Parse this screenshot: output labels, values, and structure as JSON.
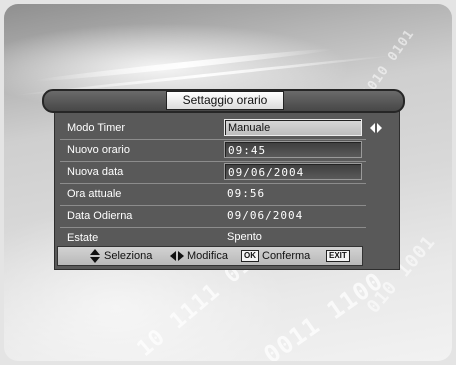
{
  "dialog": {
    "title": "Settaggio orario"
  },
  "rows": [
    {
      "label": "Modo Timer",
      "value": "Manuale"
    },
    {
      "label": "Nuovo orario",
      "value": "09:45"
    },
    {
      "label": "Nuova data",
      "value": "09/06/2004"
    },
    {
      "label": "Ora attuale",
      "value": "09:56"
    },
    {
      "label": "Data Odierna",
      "value": "09/06/2004"
    },
    {
      "label": "Estate",
      "value": "Spento"
    }
  ],
  "help": {
    "select_label": "Seleziona",
    "modify_label": "Modifica",
    "ok_key": "OK",
    "confirm_label": "Conferma",
    "exit_key": "EXIT"
  },
  "background": {
    "binary_text": [
      "1010 0101",
      "10 1111 01",
      "0011 1100",
      "010 1001"
    ]
  },
  "icons": {
    "select": "up-down-arrows-icon",
    "modify": "left-right-arrows-icon"
  }
}
